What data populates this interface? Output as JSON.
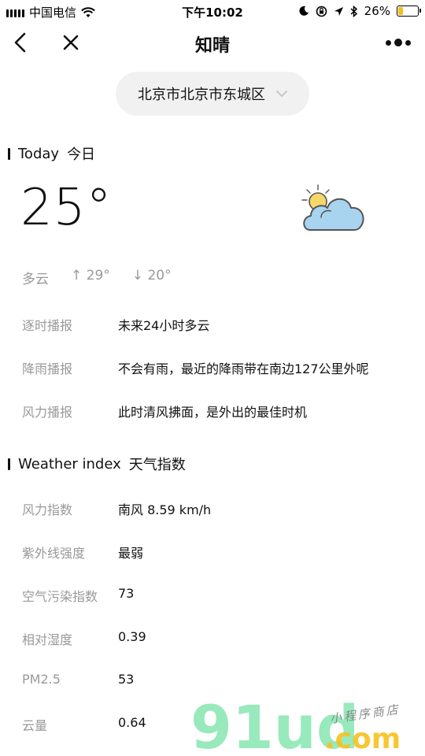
{
  "status_bar": {
    "carrier": "中国电信",
    "time": "下午10:02",
    "battery_percent": "26%",
    "battery_level": 0.26
  },
  "nav": {
    "title": "知晴"
  },
  "location": {
    "label": "北京市北京市东城区"
  },
  "today": {
    "heading_en": "Today",
    "heading_cn": "今日",
    "temperature": "25°",
    "condition": "多云",
    "high": "29°",
    "low": "20°",
    "high_arrow": "↑",
    "low_arrow": "↓"
  },
  "reports": [
    {
      "label": "逐时播报",
      "value": "未来24小时多云"
    },
    {
      "label": "降雨播报",
      "value": "不会有雨，最近的降雨带在南边127公里外呢"
    },
    {
      "label": "风力播报",
      "value": "此时清风拂面，是外出的最佳时机"
    }
  ],
  "weather_index": {
    "heading_en": "Weather index",
    "heading_cn": "天气指数",
    "items": [
      {
        "label": "风力指数",
        "value": "南风 8.59 km/h"
      },
      {
        "label": "紫外线强度",
        "value": "最弱"
      },
      {
        "label": "空气污染指数",
        "value": "73"
      },
      {
        "label": "相对湿度",
        "value": "0.39"
      },
      {
        "label": "PM2.5",
        "value": "53"
      },
      {
        "label": "云量",
        "value": "0.64"
      }
    ]
  },
  "watermark": {
    "brand": "91ud",
    "domain": ".com",
    "tagline": "小程序商店"
  },
  "colors": {
    "label_gray": "#999999",
    "cloud_blue": "#a8d4f0",
    "sun_yellow": "#f5d66b",
    "battery_yellow": "#f2c01e",
    "watermark_green": "#8de7b4",
    "watermark_domain": "#f7c21e"
  }
}
